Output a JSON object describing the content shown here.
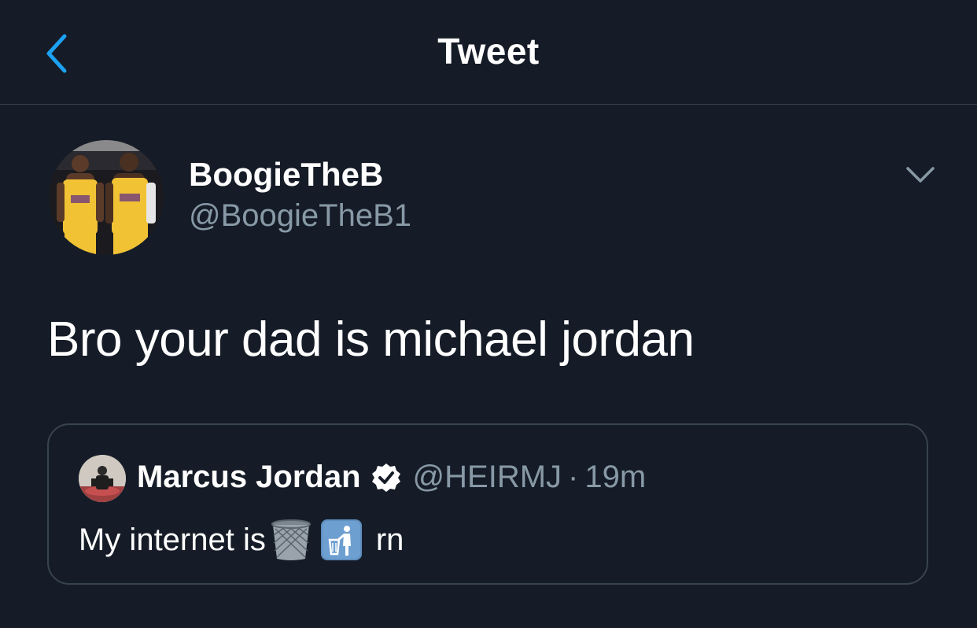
{
  "header": {
    "title": "Tweet",
    "back_icon": "chevron-left-icon"
  },
  "tweet": {
    "author_name": "BoogieTheB",
    "author_handle": "@BoogieTheB1",
    "text": "Bro your dad is michael jordan",
    "menu_icon": "chevron-down-icon"
  },
  "quoted_tweet": {
    "author_name": "Marcus Jordan",
    "verified": true,
    "author_handle": "@HEIRMJ",
    "separator": "·",
    "time": "19m",
    "text_before": "My internet is",
    "emoji_1": "wastebasket-emoji",
    "emoji_2": "put-litter-in-its-place-emoji",
    "text_after": "rn"
  },
  "colors": {
    "background": "#151c27",
    "accent": "#1da1f2",
    "secondary_text": "#8899a6",
    "border": "#38444d"
  }
}
